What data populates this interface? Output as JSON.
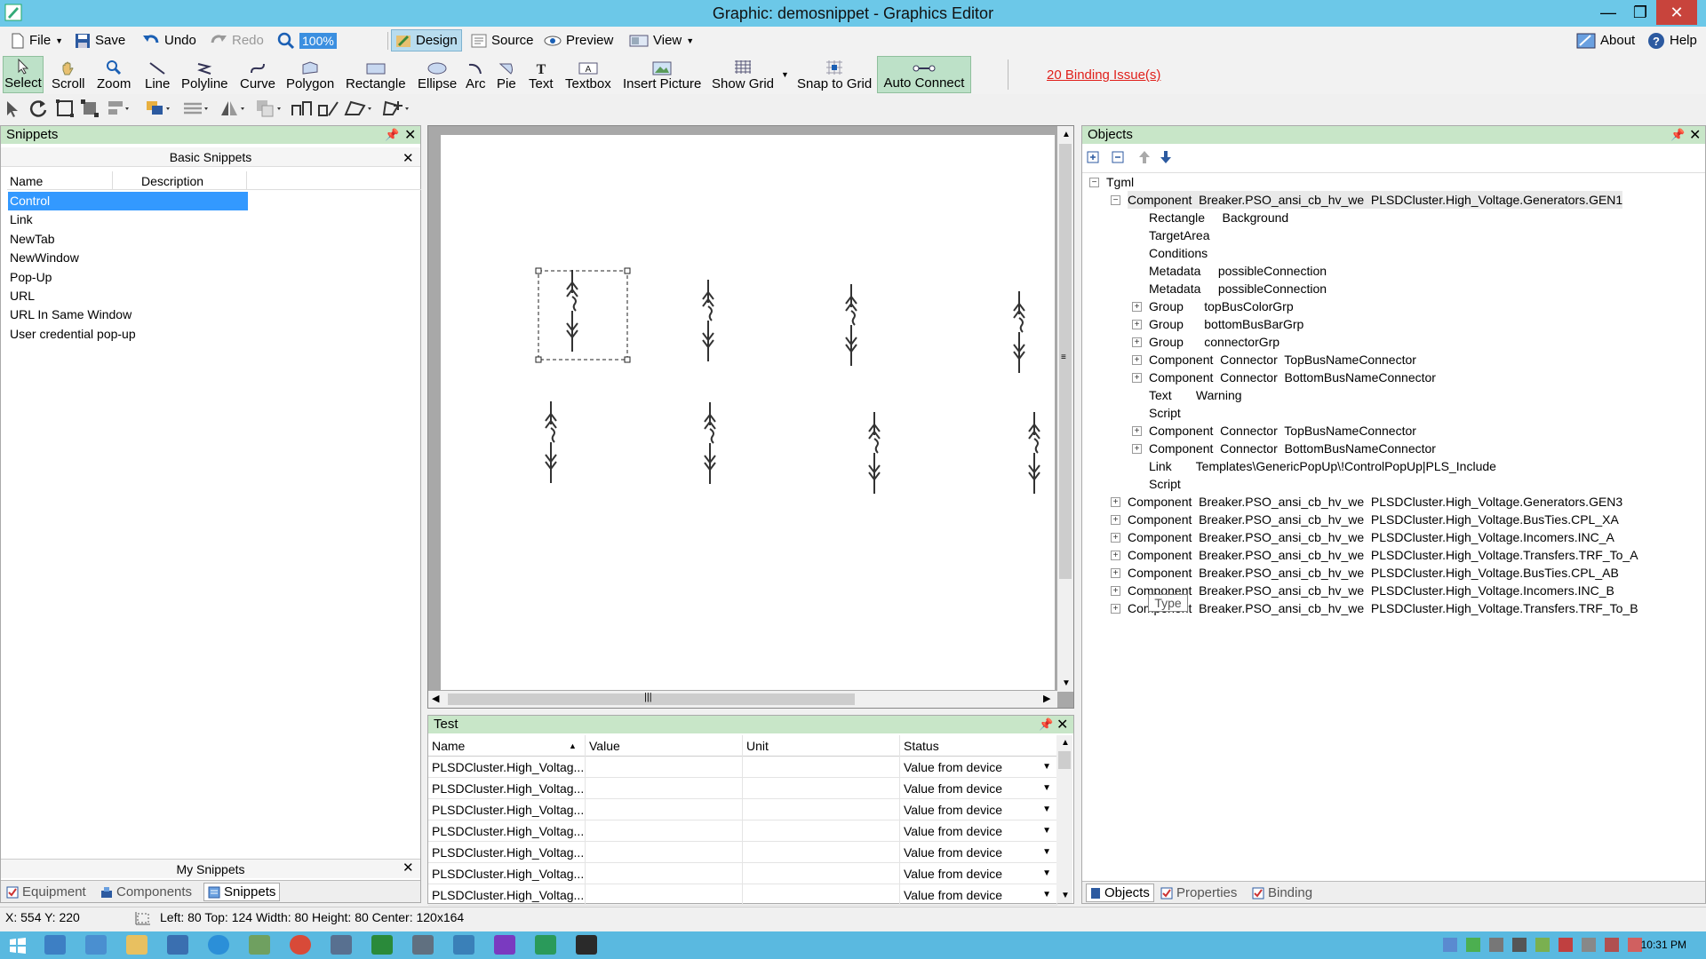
{
  "window": {
    "title": "Graphic: demosnippet - Graphics Editor"
  },
  "menu": {
    "file": "File",
    "save": "Save",
    "undo": "Undo",
    "redo": "Redo",
    "zoom_value": "100%",
    "design": "Design",
    "source": "Source",
    "preview": "Preview",
    "view": "View",
    "about": "About",
    "help": "Help"
  },
  "tools": {
    "select": "Select",
    "scroll": "Scroll",
    "zoom": "Zoom",
    "line": "Line",
    "polyline": "Polyline",
    "curve": "Curve",
    "polygon": "Polygon",
    "rectangle": "Rectangle",
    "ellipse": "Ellipse",
    "arc": "Arc",
    "pie": "Pie",
    "text": "Text",
    "textbox": "Textbox",
    "insert_picture": "Insert Picture",
    "show_grid": "Show Grid",
    "snap_to_grid": "Snap to Grid",
    "auto_connect": "Auto Connect",
    "binding_issues": "20 Binding Issue(s)"
  },
  "snippets": {
    "panel_title": "Snippets",
    "group_title": "Basic Snippets",
    "col_name": "Name",
    "col_desc": "Description",
    "items": [
      "Control",
      "Link",
      "NewTab",
      "NewWindow",
      "Pop-Up",
      "URL",
      "URL In Same Window",
      "User credential pop-up"
    ],
    "my_snippets": "My Snippets",
    "tabs": [
      "Equipment",
      "Components",
      "Snippets"
    ]
  },
  "test": {
    "panel_title": "Test",
    "headers": [
      "Name",
      "Value",
      "Unit",
      "Status"
    ],
    "rows": [
      {
        "name": "PLSDCluster.High_Voltag...",
        "value": "",
        "unit": "",
        "status": "Value from device"
      },
      {
        "name": "PLSDCluster.High_Voltag...",
        "value": "",
        "unit": "",
        "status": "Value from device"
      },
      {
        "name": "PLSDCluster.High_Voltag...",
        "value": "",
        "unit": "",
        "status": "Value from device"
      },
      {
        "name": "PLSDCluster.High_Voltag...",
        "value": "",
        "unit": "",
        "status": "Value from device"
      },
      {
        "name": "PLSDCluster.High_Voltag...",
        "value": "",
        "unit": "",
        "status": "Value from device"
      },
      {
        "name": "PLSDCluster.High_Voltag...",
        "value": "",
        "unit": "",
        "status": "Value from device"
      },
      {
        "name": "PLSDCluster.High_Voltag...",
        "value": "",
        "unit": "",
        "status": "Value from device"
      }
    ]
  },
  "objects": {
    "panel_title": "Objects",
    "root": "Tgml",
    "gen1": "Component  Breaker.PSO_ansi_cb_hv_we  PLSDCluster.High_Voltage.Generators.GEN1",
    "children": [
      {
        "exp": false,
        "text": "Rectangle     Background"
      },
      {
        "exp": false,
        "text": "TargetArea"
      },
      {
        "exp": false,
        "text": "Conditions"
      },
      {
        "exp": false,
        "text": "Metadata     possibleConnection"
      },
      {
        "exp": false,
        "text": "Metadata     possibleConnection"
      },
      {
        "exp": true,
        "text": "Group      topBusColorGrp"
      },
      {
        "exp": true,
        "text": "Group      bottomBusBarGrp"
      },
      {
        "exp": true,
        "text": "Group      connectorGrp"
      },
      {
        "exp": true,
        "text": "Component  Connector  TopBusNameConnector"
      },
      {
        "exp": true,
        "text": "Component  Connector  BottomBusNameConnector"
      },
      {
        "exp": false,
        "text": "Text       Warning"
      },
      {
        "exp": false,
        "text": "Script"
      },
      {
        "exp": true,
        "text": "Component  Connector  TopBusNameConnector"
      },
      {
        "exp": true,
        "text": "Component  Connector  BottomBusNameConnector"
      },
      {
        "exp": false,
        "text": "Link       Templates\\GenericPopUp\\!ControlPopUp|PLS_Include"
      },
      {
        "exp": false,
        "text": "Script"
      }
    ],
    "siblings": [
      "Component  Breaker.PSO_ansi_cb_hv_we  PLSDCluster.High_Voltage.Generators.GEN3",
      "Component  Breaker.PSO_ansi_cb_hv_we  PLSDCluster.High_Voltage.BusTies.CPL_XA",
      "Component  Breaker.PSO_ansi_cb_hv_we  PLSDCluster.High_Voltage.Incomers.INC_A",
      "Component  Breaker.PSO_ansi_cb_hv_we  PLSDCluster.High_Voltage.Transfers.TRF_To_A",
      "Component  Breaker.PSO_ansi_cb_hv_we  PLSDCluster.High_Voltage.BusTies.CPL_AB",
      "Component  Breaker.PSO_ansi_cb_hv_we  PLSDCluster.High_Voltage.Incomers.INC_B",
      "Component  Breaker.PSO_ansi_cb_hv_we  PLSDCluster.High_Voltage.Transfers.TRF_To_B"
    ],
    "tooltip": "Type",
    "tabs": [
      "Objects",
      "Properties",
      "Binding"
    ]
  },
  "status": {
    "cursor": "X: 554  Y: 220",
    "bounds": "Left: 80  Top: 124  Width: 80  Height: 80  Center: 120x164"
  },
  "taskbar": {
    "clock": "10:31 PM"
  },
  "colors": {
    "titlebar": "#6cc8e8",
    "panel_header": "#c8e6c8",
    "selection": "#3399ff",
    "binding_issue": "#e0201b"
  }
}
